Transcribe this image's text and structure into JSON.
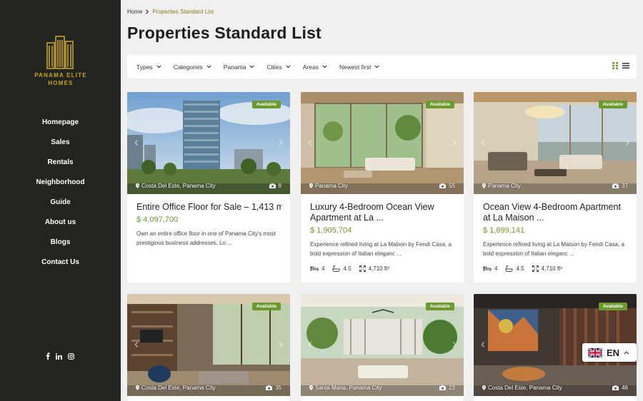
{
  "brand": {
    "line1": "PANAMA ELITE",
    "line2": "HOMES",
    "color": "#c9a227"
  },
  "nav": [
    "Homepage",
    "Sales",
    "Rentals",
    "Neighborhood",
    "Guide",
    "About us",
    "Blogs",
    "Contact Us"
  ],
  "social": [
    "facebook-icon",
    "linkedin-icon",
    "instagram-icon"
  ],
  "breadcrumb": {
    "home": "Home",
    "current": "Properties Standard List"
  },
  "page_title": "Properties Standard List",
  "filters": [
    "Types",
    "Categories",
    "Panama",
    "Cities",
    "Areas",
    "Newest first"
  ],
  "accent": "#6c9a2e",
  "cards": [
    {
      "badge": "Available",
      "location": "Costa Del Este, Panama City",
      "photos": "8",
      "title": "Entire Office Floor for Sale – 1,413 m...",
      "price": "$ 4,097,700",
      "desc": "Own an entire office floor in one of Panama City's most prestigious business addresses. Lo ...",
      "beds": "",
      "baths": "",
      "area": ""
    },
    {
      "badge": "Available",
      "location": "Panama City",
      "photos": "55",
      "title": "Luxury 4-Bedroom Ocean View Apartment at La ...",
      "price": "$ 1,905,704",
      "desc": "Experience refined living at La Maison by Fendi Casa, a bold expression of Italian eleganc ...",
      "beds": "4",
      "baths": "4.5",
      "area": "4,710 ft²"
    },
    {
      "badge": "Available",
      "location": "Panama City",
      "photos": "37",
      "title": "Ocean View 4-Bedroom Apartment at La Maison ...",
      "price": "$ 1,899,141",
      "desc": "Experience refined living at La Maison by Fendi Casa, a bold expression of Italian eleganc ...",
      "beds": "4",
      "baths": "4.5",
      "area": "4,710 ft²"
    },
    {
      "badge": "Available",
      "location": "Costa Del Este, Panama City",
      "photos": "35"
    },
    {
      "badge": "Available",
      "location": "Santa Maria, Panama City",
      "photos": "23"
    },
    {
      "badge": "Available",
      "location": "Costa Del Este, Panama City",
      "photos": "46"
    }
  ],
  "language": {
    "code": "EN",
    "flag": "uk-flag-icon"
  }
}
